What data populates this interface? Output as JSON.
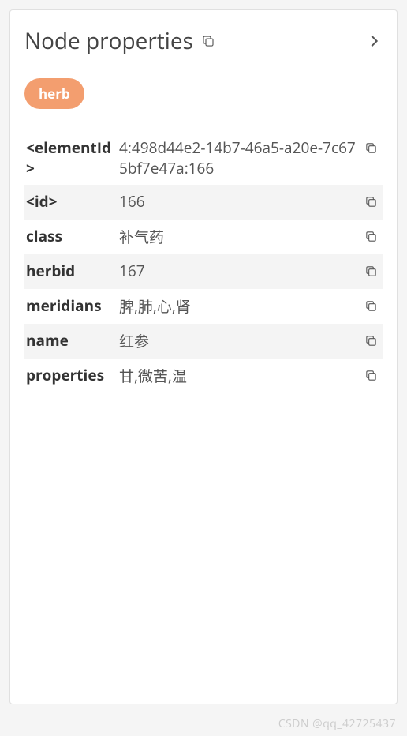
{
  "header": {
    "title": "Node properties"
  },
  "badge": {
    "label": "herb"
  },
  "properties": [
    {
      "key": "<elementId>",
      "value": "4:498d44e2-14b7-46a5-a20e-7c675bf7e47a:166",
      "alt": false
    },
    {
      "key": "<id>",
      "value": "166",
      "alt": true
    },
    {
      "key": "class",
      "value": "补气药",
      "alt": false
    },
    {
      "key": "herbid",
      "value": "167",
      "alt": true
    },
    {
      "key": "meridians",
      "value": "脾,肺,心,肾",
      "alt": false
    },
    {
      "key": "name",
      "value": "红参",
      "alt": true
    },
    {
      "key": "properties",
      "value": "甘,微苦,温",
      "alt": false
    }
  ],
  "watermark": "CSDN @qq_42725437"
}
